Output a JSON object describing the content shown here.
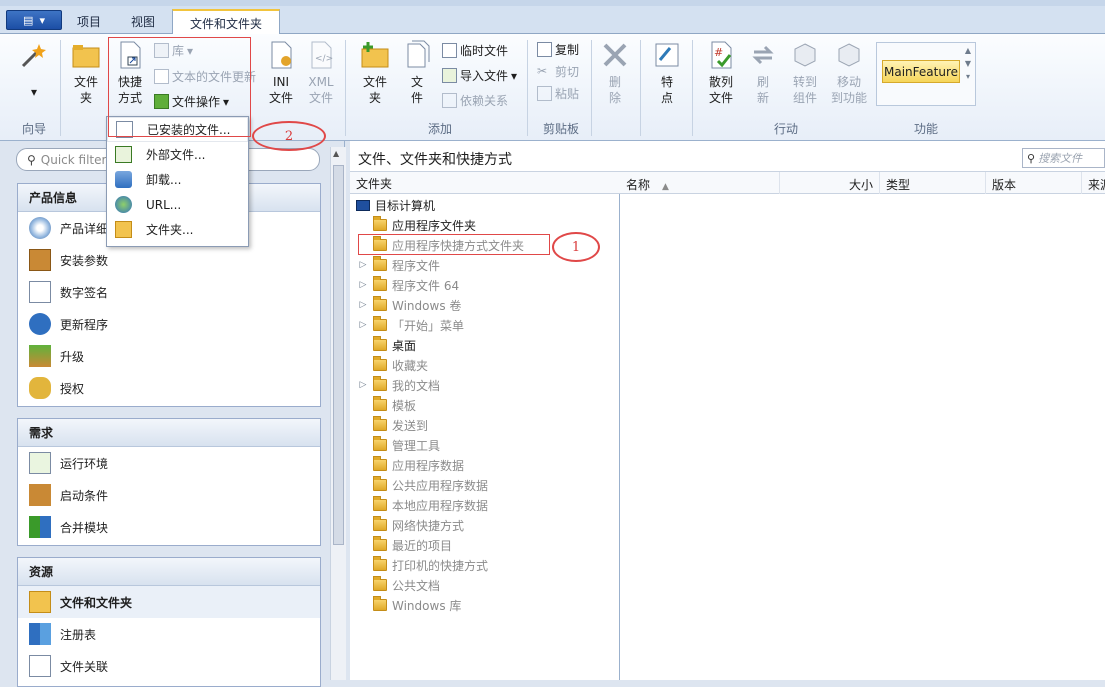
{
  "tabs": {
    "app_menu": "▤",
    "t1": "项目",
    "t2": "视图",
    "t3": "文件和文件夹"
  },
  "ribbon": {
    "wizard_group": "向导",
    "folder_btn": "文件\n夹",
    "shortcut_btn": "快捷\n方式",
    "lib_btn": "库",
    "text_update": "文本的文件更新",
    "file_ops": "文件操作",
    "ini_btn": "INI\n文件",
    "xml_btn": "XML\n文件",
    "add_folder": "文件\n夹",
    "add_file": "文\n件",
    "temp_file": "临时文件",
    "import_file": "导入文件",
    "dependency": "依赖关系",
    "add_group": "添加",
    "copy": "复制",
    "cut": "剪切",
    "paste": "粘贴",
    "clipboard_group": "剪贴板",
    "delete": "删\n除",
    "props": "特\n点",
    "hash": "散列\n文件",
    "refresh": "刷\n新",
    "goto_comp": "转到\n组件",
    "move_feature": "移动\n到功能",
    "action_group": "行动",
    "feature_value": "MainFeature",
    "feature_group": "功能"
  },
  "dropdown": [
    "已安装的文件...",
    "外部文件...",
    "卸载...",
    "URL...",
    "文件夹..."
  ],
  "left": {
    "search_placeholder": "Quick filter",
    "product_info": "产品信息",
    "product_items": [
      "产品详细",
      "安装参数",
      "数字签名",
      "更新程序",
      "升级",
      "授权"
    ],
    "requirements": "需求",
    "req_items": [
      "运行环境",
      "启动条件",
      "合并模块"
    ],
    "resources": "资源",
    "res_items": [
      "文件和文件夹",
      "注册表",
      "文件关联"
    ]
  },
  "main": {
    "title": "文件、文件夹和快捷方式",
    "search": "搜索文件",
    "tree_header": "文件夹",
    "root": "目标计算机",
    "tree": [
      {
        "label": "应用程序文件夹",
        "arrow": false,
        "bold": true
      },
      {
        "label": "应用程序快捷方式文件夹",
        "arrow": false,
        "bold": false
      },
      {
        "label": "程序文件",
        "arrow": true,
        "bold": false
      },
      {
        "label": "程序文件 64",
        "arrow": true,
        "bold": false
      },
      {
        "label": "Windows 卷",
        "arrow": true,
        "bold": false
      },
      {
        "label": "「开始」菜单",
        "arrow": true,
        "bold": false
      },
      {
        "label": "桌面",
        "arrow": false,
        "bold": true
      },
      {
        "label": "收藏夹",
        "arrow": false,
        "bold": false
      },
      {
        "label": "我的文档",
        "arrow": true,
        "bold": false
      },
      {
        "label": "模板",
        "arrow": false,
        "bold": false
      },
      {
        "label": "发送到",
        "arrow": false,
        "bold": false
      },
      {
        "label": "管理工具",
        "arrow": false,
        "bold": false
      },
      {
        "label": "应用程序数据",
        "arrow": false,
        "bold": false
      },
      {
        "label": "公共应用程序数据",
        "arrow": false,
        "bold": false
      },
      {
        "label": "本地应用程序数据",
        "arrow": false,
        "bold": false
      },
      {
        "label": "网络快捷方式",
        "arrow": false,
        "bold": false
      },
      {
        "label": "最近的项目",
        "arrow": false,
        "bold": false
      },
      {
        "label": "打印机的快捷方式",
        "arrow": false,
        "bold": false
      },
      {
        "label": "公共文档",
        "arrow": false,
        "bold": false
      },
      {
        "label": "Windows 库",
        "arrow": false,
        "bold": false
      }
    ],
    "cols": [
      "名称",
      "大小",
      "类型",
      "版本",
      "来源"
    ]
  },
  "annotations": {
    "one": "1",
    "two": "2"
  },
  "colors": {
    "accent": "#f2c43d",
    "highlight": "#e04848"
  }
}
